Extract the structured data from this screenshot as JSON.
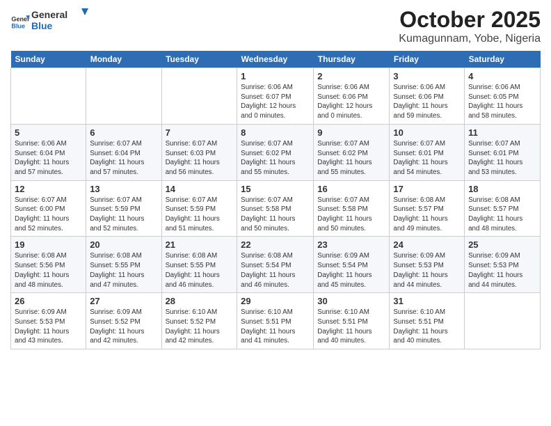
{
  "header": {
    "logo_general": "General",
    "logo_blue": "Blue",
    "title": "October 2025",
    "subtitle": "Kumagunnam, Yobe, Nigeria"
  },
  "weekdays": [
    "Sunday",
    "Monday",
    "Tuesday",
    "Wednesday",
    "Thursday",
    "Friday",
    "Saturday"
  ],
  "weeks": [
    [
      {
        "day": "",
        "info": ""
      },
      {
        "day": "",
        "info": ""
      },
      {
        "day": "",
        "info": ""
      },
      {
        "day": "1",
        "info": "Sunrise: 6:06 AM\nSunset: 6:07 PM\nDaylight: 12 hours\nand 0 minutes."
      },
      {
        "day": "2",
        "info": "Sunrise: 6:06 AM\nSunset: 6:06 PM\nDaylight: 12 hours\nand 0 minutes."
      },
      {
        "day": "3",
        "info": "Sunrise: 6:06 AM\nSunset: 6:06 PM\nDaylight: 11 hours\nand 59 minutes."
      },
      {
        "day": "4",
        "info": "Sunrise: 6:06 AM\nSunset: 6:05 PM\nDaylight: 11 hours\nand 58 minutes."
      }
    ],
    [
      {
        "day": "5",
        "info": "Sunrise: 6:06 AM\nSunset: 6:04 PM\nDaylight: 11 hours\nand 57 minutes."
      },
      {
        "day": "6",
        "info": "Sunrise: 6:07 AM\nSunset: 6:04 PM\nDaylight: 11 hours\nand 57 minutes."
      },
      {
        "day": "7",
        "info": "Sunrise: 6:07 AM\nSunset: 6:03 PM\nDaylight: 11 hours\nand 56 minutes."
      },
      {
        "day": "8",
        "info": "Sunrise: 6:07 AM\nSunset: 6:02 PM\nDaylight: 11 hours\nand 55 minutes."
      },
      {
        "day": "9",
        "info": "Sunrise: 6:07 AM\nSunset: 6:02 PM\nDaylight: 11 hours\nand 55 minutes."
      },
      {
        "day": "10",
        "info": "Sunrise: 6:07 AM\nSunset: 6:01 PM\nDaylight: 11 hours\nand 54 minutes."
      },
      {
        "day": "11",
        "info": "Sunrise: 6:07 AM\nSunset: 6:01 PM\nDaylight: 11 hours\nand 53 minutes."
      }
    ],
    [
      {
        "day": "12",
        "info": "Sunrise: 6:07 AM\nSunset: 6:00 PM\nDaylight: 11 hours\nand 52 minutes."
      },
      {
        "day": "13",
        "info": "Sunrise: 6:07 AM\nSunset: 5:59 PM\nDaylight: 11 hours\nand 52 minutes."
      },
      {
        "day": "14",
        "info": "Sunrise: 6:07 AM\nSunset: 5:59 PM\nDaylight: 11 hours\nand 51 minutes."
      },
      {
        "day": "15",
        "info": "Sunrise: 6:07 AM\nSunset: 5:58 PM\nDaylight: 11 hours\nand 50 minutes."
      },
      {
        "day": "16",
        "info": "Sunrise: 6:07 AM\nSunset: 5:58 PM\nDaylight: 11 hours\nand 50 minutes."
      },
      {
        "day": "17",
        "info": "Sunrise: 6:08 AM\nSunset: 5:57 PM\nDaylight: 11 hours\nand 49 minutes."
      },
      {
        "day": "18",
        "info": "Sunrise: 6:08 AM\nSunset: 5:57 PM\nDaylight: 11 hours\nand 48 minutes."
      }
    ],
    [
      {
        "day": "19",
        "info": "Sunrise: 6:08 AM\nSunset: 5:56 PM\nDaylight: 11 hours\nand 48 minutes."
      },
      {
        "day": "20",
        "info": "Sunrise: 6:08 AM\nSunset: 5:55 PM\nDaylight: 11 hours\nand 47 minutes."
      },
      {
        "day": "21",
        "info": "Sunrise: 6:08 AM\nSunset: 5:55 PM\nDaylight: 11 hours\nand 46 minutes."
      },
      {
        "day": "22",
        "info": "Sunrise: 6:08 AM\nSunset: 5:54 PM\nDaylight: 11 hours\nand 46 minutes."
      },
      {
        "day": "23",
        "info": "Sunrise: 6:09 AM\nSunset: 5:54 PM\nDaylight: 11 hours\nand 45 minutes."
      },
      {
        "day": "24",
        "info": "Sunrise: 6:09 AM\nSunset: 5:53 PM\nDaylight: 11 hours\nand 44 minutes."
      },
      {
        "day": "25",
        "info": "Sunrise: 6:09 AM\nSunset: 5:53 PM\nDaylight: 11 hours\nand 44 minutes."
      }
    ],
    [
      {
        "day": "26",
        "info": "Sunrise: 6:09 AM\nSunset: 5:53 PM\nDaylight: 11 hours\nand 43 minutes."
      },
      {
        "day": "27",
        "info": "Sunrise: 6:09 AM\nSunset: 5:52 PM\nDaylight: 11 hours\nand 42 minutes."
      },
      {
        "day": "28",
        "info": "Sunrise: 6:10 AM\nSunset: 5:52 PM\nDaylight: 11 hours\nand 42 minutes."
      },
      {
        "day": "29",
        "info": "Sunrise: 6:10 AM\nSunset: 5:51 PM\nDaylight: 11 hours\nand 41 minutes."
      },
      {
        "day": "30",
        "info": "Sunrise: 6:10 AM\nSunset: 5:51 PM\nDaylight: 11 hours\nand 40 minutes."
      },
      {
        "day": "31",
        "info": "Sunrise: 6:10 AM\nSunset: 5:51 PM\nDaylight: 11 hours\nand 40 minutes."
      },
      {
        "day": "",
        "info": ""
      }
    ]
  ]
}
